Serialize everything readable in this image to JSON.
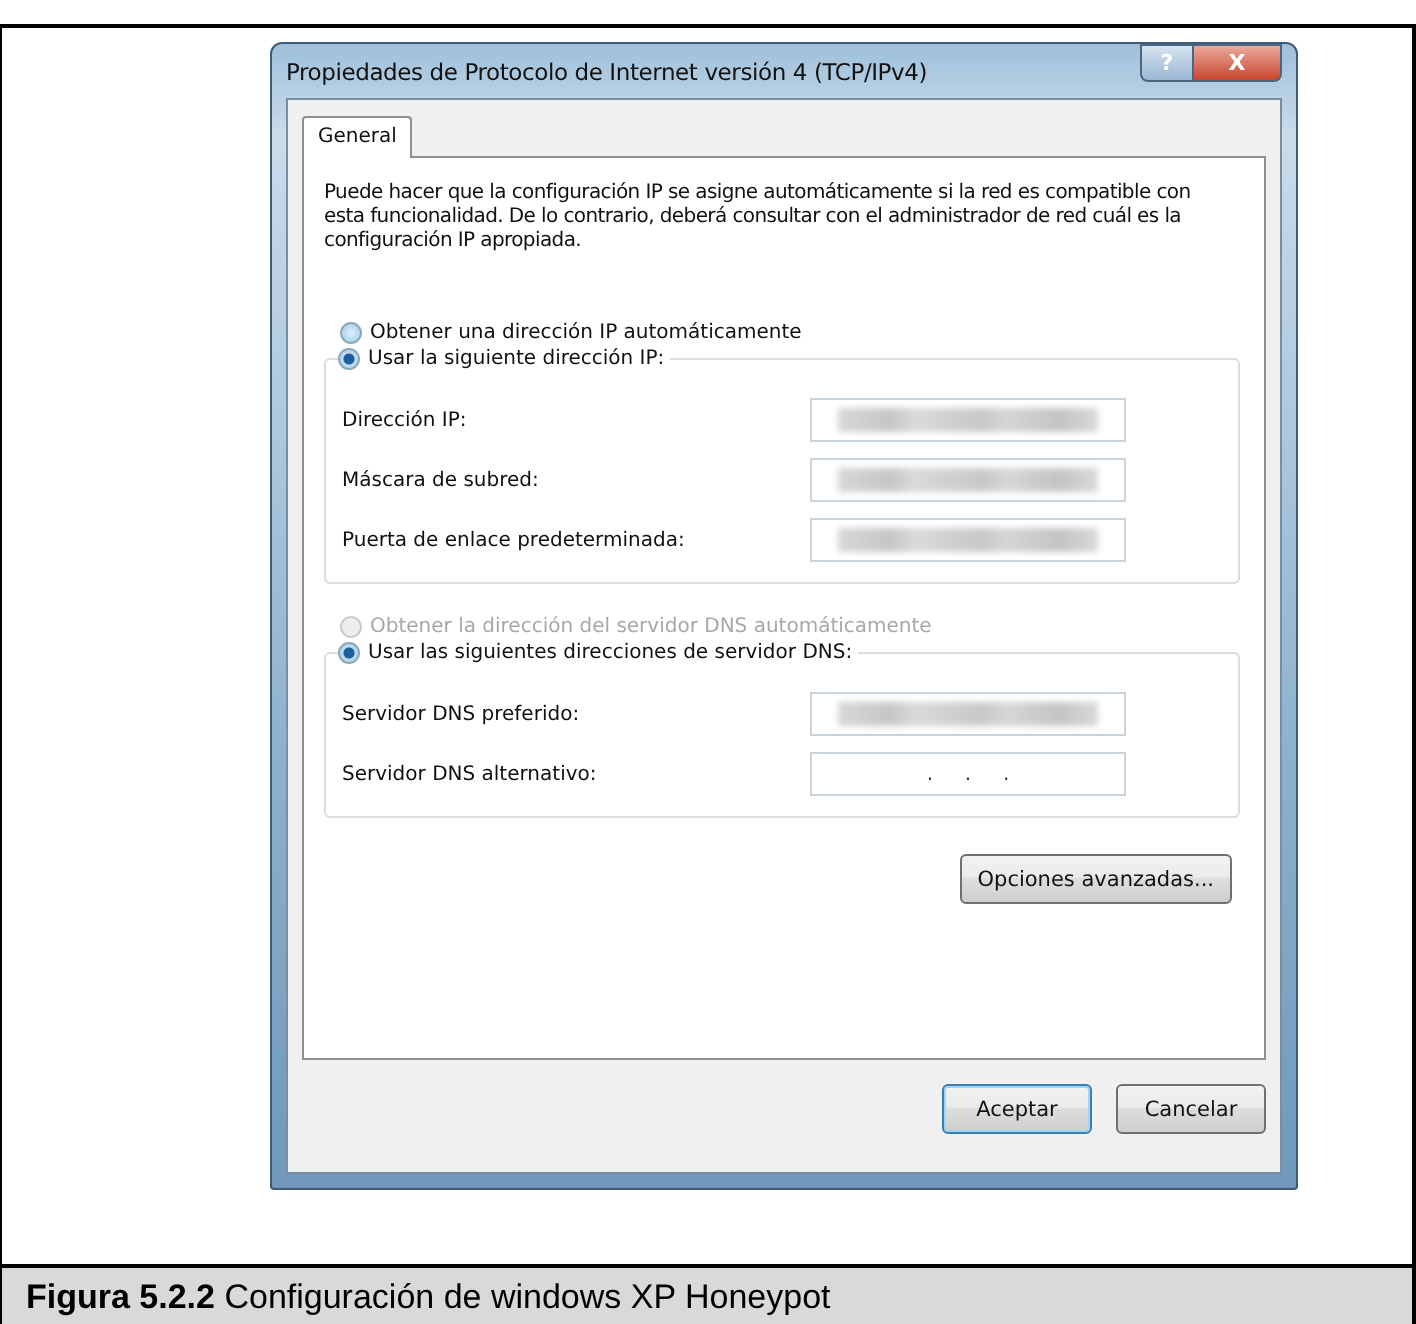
{
  "window": {
    "title": "Propiedades de Protocolo de Internet versión 4 (TCP/IPv4)",
    "help": "?",
    "close": "X"
  },
  "tabs": [
    {
      "label": "General",
      "selected": true
    }
  ],
  "description": "Puede hacer que la configuración IP se asigne automáticamente si la red es compatible con esta funcionalidad. De lo contrario, deberá consultar con el administrador de red cuál es la configuración IP apropiada.",
  "sections": [
    {
      "auto_option": {
        "label": "Obtener una dirección IP automáticamente",
        "selected": false,
        "disabled": false
      },
      "manual_option": {
        "label": "Usar la siguiente dirección IP:",
        "selected": true,
        "disabled": false
      },
      "fields": [
        {
          "label": "Dirección IP:",
          "blurred": true
        },
        {
          "label": "Máscara de subred:",
          "blurred": true
        },
        {
          "label": "Puerta de enlace predeterminada:",
          "blurred": true
        }
      ]
    },
    {
      "auto_option": {
        "label": "Obtener la dirección del servidor DNS automáticamente",
        "selected": false,
        "disabled": true
      },
      "manual_option": {
        "label": "Usar las siguientes direcciones de servidor DNS:",
        "selected": true,
        "disabled": false
      },
      "fields": [
        {
          "label": "Servidor DNS preferido:",
          "blurred": true
        },
        {
          "label": "Servidor DNS alternativo:",
          "blurred": false,
          "value": ".     .     ."
        }
      ]
    }
  ],
  "advanced_button": "Opciones avanzadas...",
  "buttons": [
    {
      "label": "Aceptar",
      "default": true
    },
    {
      "label": "Cancelar",
      "default": false
    }
  ],
  "caption": "**Figura 5.2.2** Configuración de windows XP Honeypot"
}
